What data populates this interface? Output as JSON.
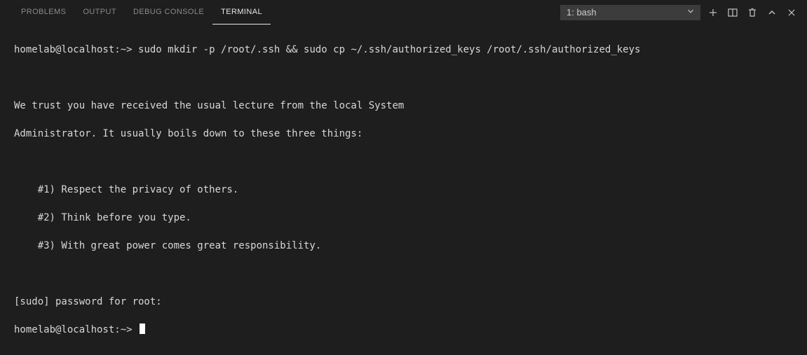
{
  "tabs": {
    "problems": "PROBLEMS",
    "output": "OUTPUT",
    "debug": "DEBUG CONSOLE",
    "terminal": "TERMINAL"
  },
  "terminalSelector": {
    "label": "1: bash"
  },
  "icons": {
    "chevronDown": "chevron-down-icon",
    "new": "plus-icon",
    "split": "split-icon",
    "kill": "trash-icon",
    "maximize": "chevron-up-icon",
    "close": "close-icon"
  },
  "term": {
    "line1_prompt": "homelab@localhost:~> ",
    "line1_cmd": "sudo mkdir -p /root/.ssh && sudo cp ~/.ssh/authorized_keys /root/.ssh/authorized_keys",
    "blank1": "",
    "lec1": "We trust you have received the usual lecture from the local System",
    "lec2": "Administrator. It usually boils down to these three things:",
    "blank2": "",
    "r1": "#1) Respect the privacy of others.",
    "r2": "#2) Think before you type.",
    "r3": "#3) With great power comes great responsibility.",
    "blank3": "",
    "pw": "[sudo] password for root:",
    "prompt2": "homelab@localhost:~> "
  }
}
